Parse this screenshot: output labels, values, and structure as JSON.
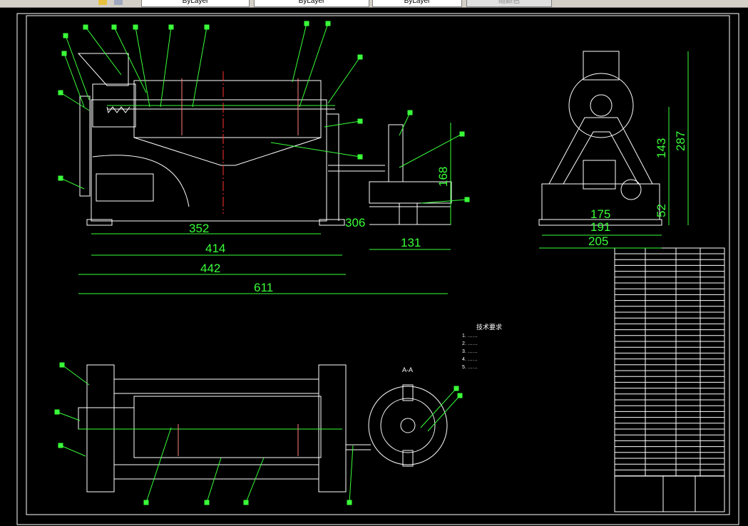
{
  "toolbar": {
    "layer_combo": "ByLayer",
    "linetype_combo": "ByLayer",
    "lineweight_combo": "ByLayer",
    "plotstyle_combo": "随颜色"
  },
  "drawing": {
    "section_label": "A-A",
    "notes_title": "技术要求",
    "notes": [
      "1. ……",
      "2. ……",
      "3. ……",
      "4. ……",
      "5. ……"
    ],
    "front_dims": {
      "d352": "352",
      "d414": "414",
      "d442": "442",
      "d611": "611",
      "d306": "306",
      "d168": "168",
      "d131": "131"
    },
    "side_dims": {
      "d287": "287",
      "d143": "143",
      "d52": "52",
      "d175": "175",
      "d191": "191",
      "d205": "205"
    }
  },
  "colors": {
    "background": "#000000",
    "geometry": "#ffffff",
    "dimension": "#39ff39",
    "centerline": "#ff3030",
    "part": "#3050ff"
  }
}
